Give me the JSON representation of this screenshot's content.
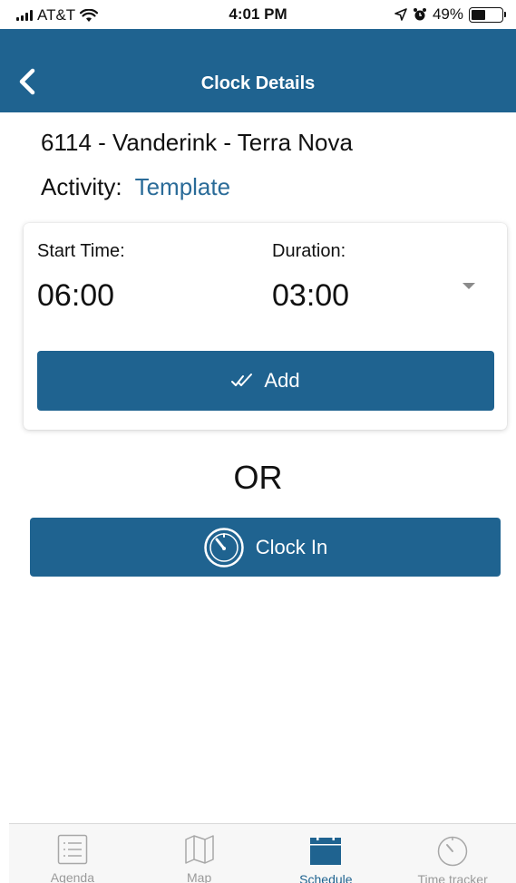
{
  "status_bar": {
    "carrier": "AT&T",
    "time": "4:01 PM",
    "battery": "49%",
    "battery_level": 0.49
  },
  "header": {
    "title": "Clock Details",
    "back_icon": "chevron-left-icon"
  },
  "job": {
    "title": "6114 - Vanderink - Terra Nova",
    "activity_label": "Activity:",
    "activity_value": "Template"
  },
  "entry_card": {
    "start_time_label": "Start Time:",
    "start_time_value": "06:00",
    "duration_label": "Duration:",
    "duration_value": "03:00",
    "add_label": "Add",
    "add_icon": "double-check-icon"
  },
  "or_label": "OR",
  "clock_in": {
    "label": "Clock In",
    "icon": "stopwatch-icon"
  },
  "tab_bar": {
    "items": [
      {
        "label": "Agenda",
        "icon": "list-icon",
        "active": false
      },
      {
        "label": "Map",
        "icon": "map-icon",
        "active": false
      },
      {
        "label": "Schedule",
        "icon": "calendar-icon",
        "active": true
      },
      {
        "label": "Time tracker",
        "icon": "stopwatch-icon",
        "active": false
      }
    ]
  },
  "colors": {
    "primary": "#1f6390",
    "accent_text": "#2a6b98",
    "tab_inactive": "#9a9a9a"
  }
}
